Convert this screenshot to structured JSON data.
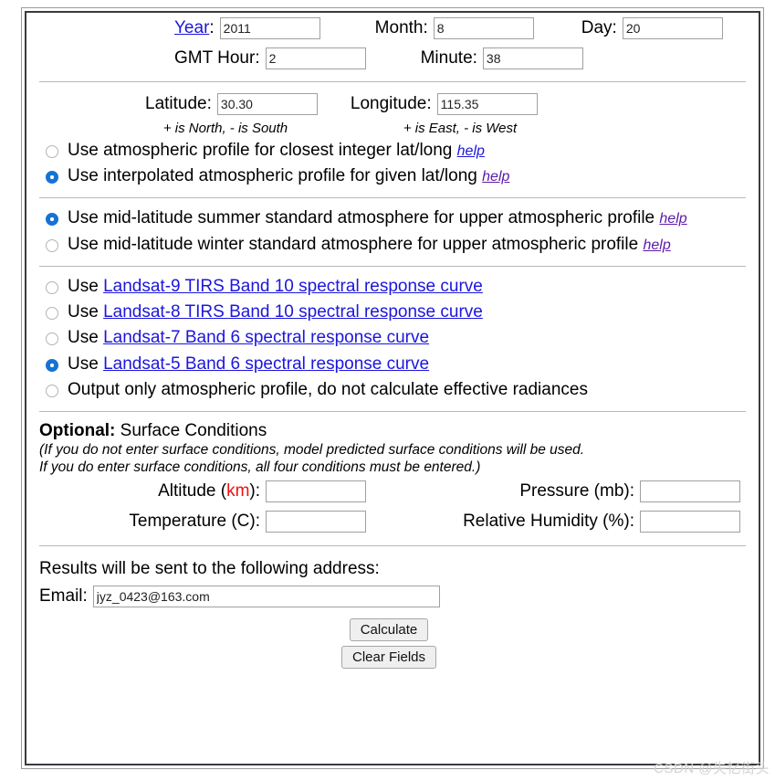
{
  "datetime": {
    "year_label": "Year",
    "year_colon": ":",
    "year_value": "2011",
    "month_label": "Month:",
    "month_value": "8",
    "day_label": "Day:",
    "day_value": "20",
    "gmt_hour_label": "GMT Hour:",
    "gmt_hour_value": "2",
    "minute_label": "Minute:",
    "minute_value": "38"
  },
  "geo": {
    "latitude_label": "Latitude:",
    "latitude_value": "30.30",
    "longitude_label": "Longitude:",
    "longitude_value": "115.35",
    "latitude_hint": "+ is North, - is South",
    "longitude_hint": "+ is East, - is West"
  },
  "profile_options": [
    {
      "text": "Use atmospheric profile for closest integer lat/long",
      "help": "help",
      "selected": false
    },
    {
      "text": "Use interpolated atmospheric profile for given lat/long",
      "help": "help",
      "selected": true
    }
  ],
  "upper_atmosphere_options": [
    {
      "text": "Use mid-latitude summer standard atmosphere for upper atmospheric profile",
      "help": "help",
      "selected": true
    },
    {
      "text": "Use mid-latitude winter standard atmosphere for upper atmospheric profile",
      "help": "help",
      "selected": false
    }
  ],
  "sensor_options": [
    {
      "prefix": "Use ",
      "link": "Landsat-9 TIRS Band 10 spectral response curve",
      "selected": false
    },
    {
      "prefix": "Use ",
      "link": "Landsat-8 TIRS Band 10 spectral response curve",
      "selected": false
    },
    {
      "prefix": "Use ",
      "link": "Landsat-7 Band 6 spectral response curve",
      "selected": false
    },
    {
      "prefix": "Use ",
      "link": "Landsat-5 Band 6 spectral response curve",
      "selected": true
    },
    {
      "prefix": "Output only atmospheric profile, do not calculate effective radiances",
      "link": "",
      "selected": false
    }
  ],
  "surface": {
    "title_bold": "Optional:",
    "title_rest": " Surface Conditions",
    "note_line1": "(If you do not enter surface conditions, model predicted surface conditions will be used.",
    "note_line2": "If you do enter surface conditions, all four conditions must be entered.)",
    "altitude_label_pre": "Altitude (",
    "altitude_label_unit": "km",
    "altitude_label_post": "):",
    "altitude_value": "",
    "pressure_label": "Pressure (mb):",
    "pressure_value": "",
    "temperature_label": "Temperature (C):",
    "temperature_value": "",
    "humidity_label": "Relative Humidity (%):",
    "humidity_value": ""
  },
  "email_section": {
    "results_text": "Results will be sent to the following address:",
    "email_label": "Email:",
    "email_value": "jyz_0423@163.com"
  },
  "buttons": {
    "calculate": "Calculate",
    "clear": "Clear Fields"
  },
  "watermark": "CSDN @失忆街头",
  "colors": {
    "link": "#1c16dc",
    "visited_link": "#5c1aa8",
    "radio_selected": "#1673d4",
    "red_unit": "#ee1111",
    "watermark": "#d2d2d2"
  }
}
